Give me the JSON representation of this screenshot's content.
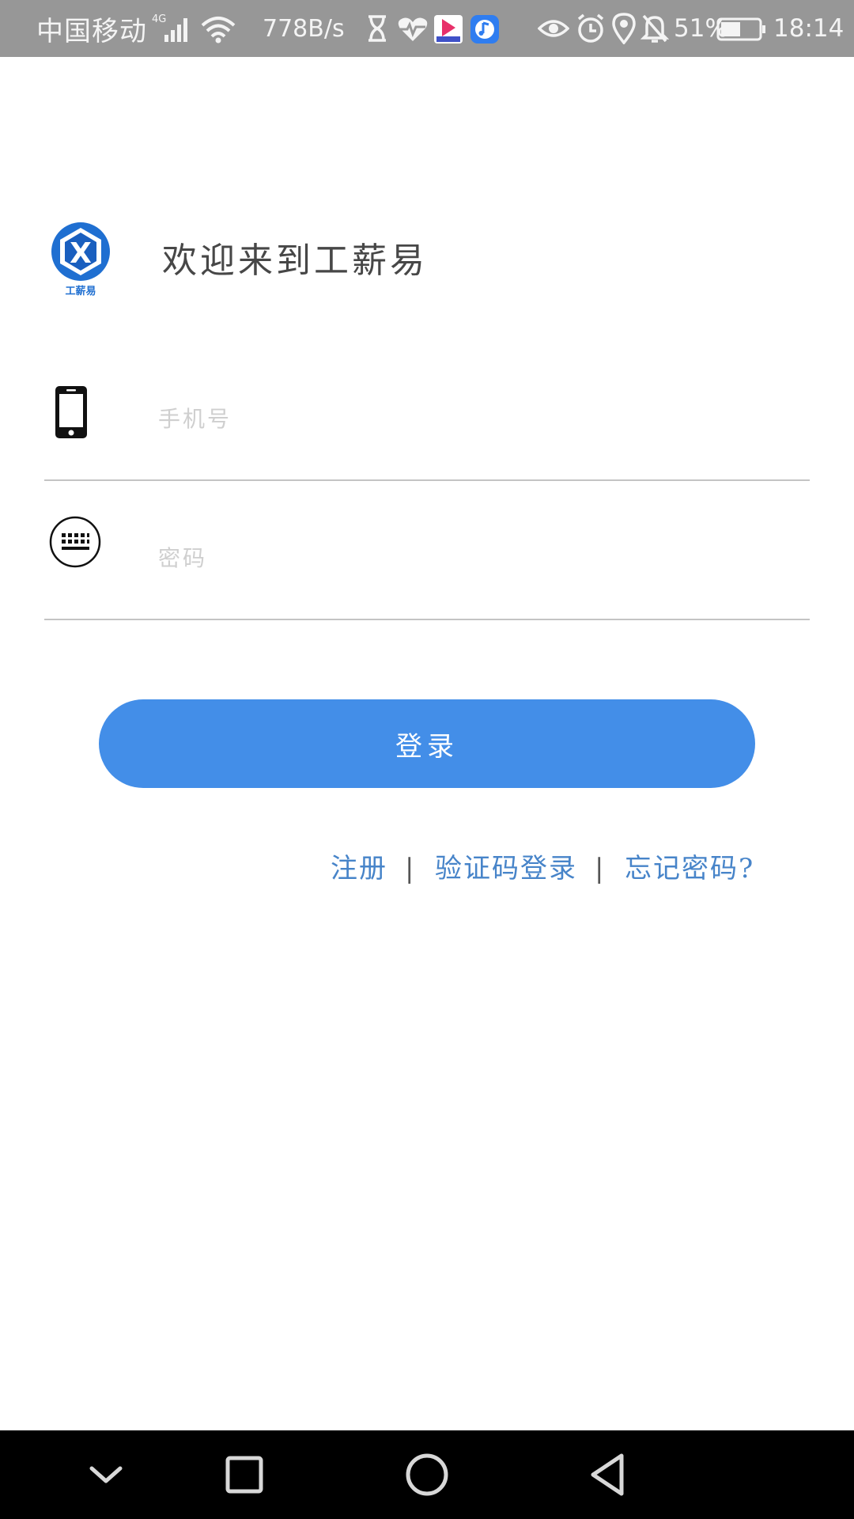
{
  "status_bar": {
    "carrier": "中国移动",
    "network_type": "4G",
    "net_speed": "778B/s",
    "battery_percent": "51%",
    "time": "18:14",
    "icons": [
      "signal-icon",
      "wifi-icon",
      "hourglass-icon",
      "heart-rate-icon",
      "app-notification-icon",
      "music-app-icon",
      "eye-icon",
      "alarm-icon",
      "location-icon",
      "mute-icon",
      "battery-icon"
    ]
  },
  "header": {
    "logo_text": "工薪易",
    "logo_letter": "X",
    "welcome": "欢迎来到工薪易"
  },
  "form": {
    "phone": {
      "placeholder": "手机号",
      "value": "",
      "icon": "phone-icon"
    },
    "password": {
      "placeholder": "密码",
      "value": "",
      "icon": "keyboard-icon"
    }
  },
  "login_button": {
    "label": "登录"
  },
  "links": {
    "register": "注册",
    "separator": "|",
    "sms_login": "验证码登录",
    "forgot_password": "忘记密码?"
  },
  "nav_bar": {
    "icons": [
      "chevron-down-icon",
      "square-icon",
      "circle-icon",
      "triangle-back-icon"
    ]
  },
  "colors": {
    "status_bar": "#979797",
    "accent": "#438ee8",
    "link": "#4784c9",
    "divider": "#c4c4c4",
    "logo_blue": "#1f6fd1"
  }
}
